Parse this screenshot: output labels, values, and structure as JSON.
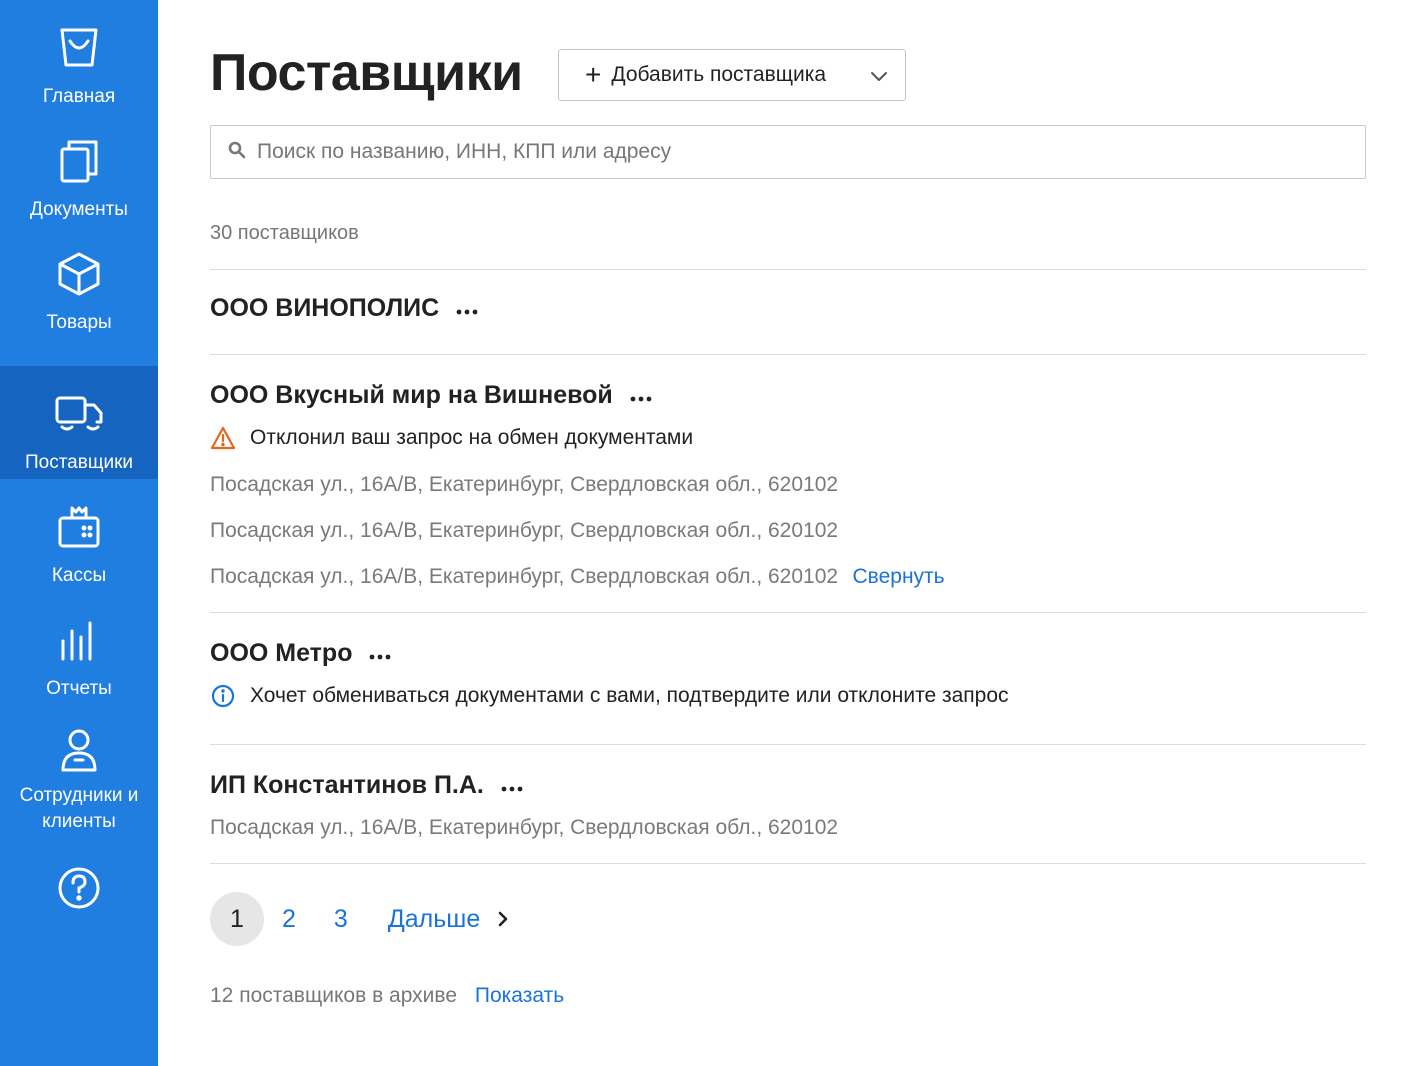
{
  "sidebar": {
    "items": [
      {
        "label": "Главная",
        "icon": "shopping-bag-icon"
      },
      {
        "label": "Документы",
        "icon": "documents-icon"
      },
      {
        "label": "Товары",
        "icon": "box-icon"
      },
      {
        "label": "Поставщики",
        "icon": "truck-icon",
        "active": true
      },
      {
        "label": "Кассы",
        "icon": "cash-register-icon"
      },
      {
        "label": "Отчеты",
        "icon": "bar-chart-icon"
      },
      {
        "label": "Сотрудники и клиенты",
        "icon": "person-icon"
      },
      {
        "label": "",
        "icon": "help-icon"
      }
    ]
  },
  "header": {
    "title": "Поставщики",
    "add_button_label": "Добавить поставщика"
  },
  "search": {
    "placeholder": "Поиск по названию, ИНН, КПП или адресу",
    "value": ""
  },
  "summary": {
    "count_text": "30 поставщиков"
  },
  "suppliers": [
    {
      "name": "ООО ВИНОПОЛИС"
    },
    {
      "name": "ООО Вкусный мир на Вишневой",
      "status": "Отклонил ваш запрос на обмен документами",
      "status_icon": "warning-icon",
      "addresses": [
        "Посадская ул., 16А/В, Екатеринбург, Свердловская обл., 620102",
        "Посадская ул., 16А/В, Екатеринбург, Свердловская обл., 620102",
        "Посадская ул., 16А/В, Екатеринбург, Свердловская обл., 620102"
      ],
      "collapse_label": "Свернуть"
    },
    {
      "name": "ООО Метро",
      "status": "Хочет обмениваться документами с вами, подтвердите или отклоните запрос",
      "status_icon": "info-icon"
    },
    {
      "name": "ИП Константинов П.А.",
      "addresses": [
        "Посадская ул., 16А/В, Екатеринбург, Свердловская обл., 620102"
      ]
    }
  ],
  "pagination": {
    "pages": [
      "1",
      "2",
      "3"
    ],
    "current": "1",
    "next_label": "Дальше"
  },
  "archive": {
    "text": "12 поставщиков в архиве",
    "show_label": "Показать"
  },
  "colors": {
    "sidebar_bg": "#1f7ee0",
    "sidebar_active": "#1565c0",
    "link": "#1a73d9",
    "warning": "#e8631c",
    "info": "#1a73d9"
  }
}
